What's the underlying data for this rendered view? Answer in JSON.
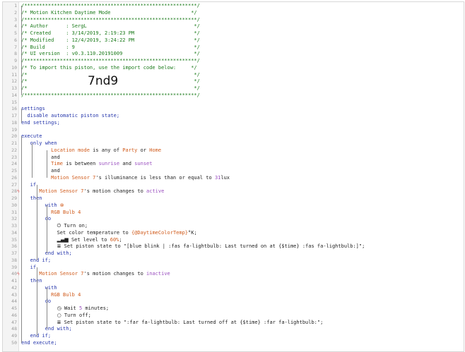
{
  "lines": [
    {
      "n": "1",
      "parts": [
        {
          "t": "/**********************************************************/",
          "c": "cm"
        }
      ]
    },
    {
      "n": "2",
      "parts": [
        {
          "t": "/* Motion Kitchen Daytime Mode                           */",
          "c": "cm"
        }
      ]
    },
    {
      "n": "3",
      "parts": [
        {
          "t": "/**********************************************************/",
          "c": "cm"
        }
      ]
    },
    {
      "n": "4",
      "parts": [
        {
          "t": "/* Author      : SergL                                    */",
          "c": "cm"
        }
      ]
    },
    {
      "n": "5",
      "parts": [
        {
          "t": "/* Created     : 3/14/2019, 2:19:23 PM                    */",
          "c": "cm"
        }
      ]
    },
    {
      "n": "6",
      "parts": [
        {
          "t": "/* Modified    : 12/4/2019, 3:24:22 PM                    */",
          "c": "cm"
        }
      ]
    },
    {
      "n": "7",
      "parts": [
        {
          "t": "/* Build       : 9                                        */",
          "c": "cm"
        }
      ]
    },
    {
      "n": "8",
      "parts": [
        {
          "t": "/* UI version  : v0.3.110.20191009                        */",
          "c": "cm"
        }
      ]
    },
    {
      "n": "9",
      "parts": [
        {
          "t": "/**********************************************************/",
          "c": "cm"
        }
      ]
    },
    {
      "n": "10",
      "parts": [
        {
          "t": "/* To import this piston, use the import code below:     */",
          "c": "cm"
        }
      ]
    },
    {
      "n": "11",
      "parts": [
        {
          "t": "/*                                                        */",
          "c": "cm"
        }
      ]
    },
    {
      "n": "12",
      "parts": [
        {
          "t": "/*                                                        */",
          "c": "cm"
        }
      ]
    },
    {
      "n": "13",
      "parts": [
        {
          "t": "/*                                                        */",
          "c": "cm"
        }
      ]
    },
    {
      "n": "14",
      "parts": [
        {
          "t": "/**********************************************************/",
          "c": "cm"
        }
      ]
    },
    {
      "n": "15",
      "parts": []
    },
    {
      "n": "16",
      "parts": [
        {
          "t": "settings",
          "c": "kw"
        }
      ]
    },
    {
      "n": "17",
      "parts": [
        {
          "t": "  disable automatic piston state;",
          "c": "kw"
        }
      ]
    },
    {
      "n": "18",
      "parts": [
        {
          "t": "end settings;",
          "c": "kw"
        }
      ]
    },
    {
      "n": "19",
      "parts": []
    },
    {
      "n": "20",
      "parts": [
        {
          "t": "execute",
          "c": "kw"
        }
      ]
    },
    {
      "n": "21",
      "parts": [
        {
          "t": "   only when",
          "c": "kw"
        }
      ]
    },
    {
      "n": "22",
      "parts": [
        {
          "t": "          Location mode",
          "c": "var"
        },
        {
          "t": " is any of ",
          "c": "plain"
        },
        {
          "t": "Party",
          "c": "var"
        },
        {
          "t": " or ",
          "c": "plain"
        },
        {
          "t": "Home",
          "c": "var"
        }
      ]
    },
    {
      "n": "23",
      "parts": [
        {
          "t": "          and",
          "c": "plain"
        }
      ]
    },
    {
      "n": "24",
      "parts": [
        {
          "t": "          Time",
          "c": "var"
        },
        {
          "t": " is between ",
          "c": "plain"
        },
        {
          "t": "sunrise",
          "c": "val"
        },
        {
          "t": " and ",
          "c": "plain"
        },
        {
          "t": "sunset",
          "c": "val"
        }
      ]
    },
    {
      "n": "25",
      "parts": [
        {
          "t": "          and",
          "c": "plain"
        }
      ]
    },
    {
      "n": "26",
      "parts": [
        {
          "t": "          Motion Sensor 7",
          "c": "var"
        },
        {
          "t": "'s illuminance is less than or equal to ",
          "c": "plain"
        },
        {
          "t": "31",
          "c": "val"
        },
        {
          "t": "lux",
          "c": "plain"
        }
      ]
    },
    {
      "n": "27",
      "parts": [
        {
          "t": "   if",
          "c": "kw"
        }
      ]
    },
    {
      "n": "28",
      "bolt": true,
      "parts": [
        {
          "t": "      Motion Sensor 7",
          "c": "var"
        },
        {
          "t": "'s motion changes to ",
          "c": "plain"
        },
        {
          "t": "active",
          "c": "val"
        }
      ]
    },
    {
      "n": "29",
      "parts": [
        {
          "t": "   then",
          "c": "kw"
        }
      ]
    },
    {
      "n": "30",
      "parts": [
        {
          "t": "        with ",
          "c": "kw"
        },
        {
          "t": "⊗",
          "c": "var",
          "icon": "stop-icon"
        }
      ]
    },
    {
      "n": "31",
      "parts": [
        {
          "t": "          RGB Bulb 4",
          "c": "var"
        }
      ]
    },
    {
      "n": "32",
      "parts": [
        {
          "t": "        do",
          "c": "kw"
        }
      ]
    },
    {
      "n": "33",
      "parts": [
        {
          "t": "            ",
          "c": "plain"
        },
        {
          "t": "⏻",
          "c": "plain",
          "icon": "power-icon"
        },
        {
          "t": " Turn on;",
          "c": "plain"
        }
      ]
    },
    {
      "n": "34",
      "parts": [
        {
          "t": "            Set color temperature to ",
          "c": "plain"
        },
        {
          "t": "{@DaytimeColorTemp}",
          "c": "var"
        },
        {
          "t": "°K;",
          "c": "plain"
        }
      ]
    },
    {
      "n": "35",
      "parts": [
        {
          "t": "            ",
          "c": "plain"
        },
        {
          "t": "▂▄▆",
          "c": "plain",
          "icon": "signal-icon"
        },
        {
          "t": " Set level to ",
          "c": "plain"
        },
        {
          "t": "60%",
          "c": "var"
        },
        {
          "t": ";",
          "c": "plain"
        }
      ]
    },
    {
      "n": "36",
      "parts": [
        {
          "t": "            ",
          "c": "plain"
        },
        {
          "t": "≣",
          "c": "plain",
          "icon": "list-icon"
        },
        {
          "t": " Set piston state to \"[blue blink | :fas fa-lightbulb: Last turned on at {$time} :fas fa-lightbulb:]\";",
          "c": "plain"
        }
      ]
    },
    {
      "n": "37",
      "parts": [
        {
          "t": "        end with;",
          "c": "kw"
        }
      ]
    },
    {
      "n": "38",
      "parts": [
        {
          "t": "   end if;",
          "c": "kw"
        }
      ]
    },
    {
      "n": "39",
      "parts": [
        {
          "t": "   if",
          "c": "kw"
        }
      ]
    },
    {
      "n": "40",
      "bolt": true,
      "parts": [
        {
          "t": "      Motion Sensor 7",
          "c": "var"
        },
        {
          "t": "'s motion changes to ",
          "c": "plain"
        },
        {
          "t": "inactive",
          "c": "val"
        }
      ]
    },
    {
      "n": "41",
      "parts": [
        {
          "t": "   then",
          "c": "kw"
        }
      ]
    },
    {
      "n": "42",
      "parts": [
        {
          "t": "        with",
          "c": "kw"
        }
      ]
    },
    {
      "n": "43",
      "parts": [
        {
          "t": "          RGB Bulb 4",
          "c": "var"
        }
      ]
    },
    {
      "n": "44",
      "parts": [
        {
          "t": "        do",
          "c": "kw"
        }
      ]
    },
    {
      "n": "45",
      "parts": [
        {
          "t": "            ",
          "c": "plain"
        },
        {
          "t": "◷",
          "c": "plain",
          "icon": "clock-icon"
        },
        {
          "t": " Wait ",
          "c": "plain"
        },
        {
          "t": "5",
          "c": "val"
        },
        {
          "t": " minutes;",
          "c": "plain"
        }
      ]
    },
    {
      "n": "46",
      "parts": [
        {
          "t": "            ",
          "c": "plain"
        },
        {
          "t": "○",
          "c": "plain",
          "icon": "circle-icon"
        },
        {
          "t": " Turn off;",
          "c": "plain"
        }
      ]
    },
    {
      "n": "47",
      "parts": [
        {
          "t": "            ",
          "c": "plain"
        },
        {
          "t": "≣",
          "c": "plain",
          "icon": "list-icon"
        },
        {
          "t": " Set piston state to \":far fa-lightbulb: Last turned off at {$time} :far fa-lightbulb:\";",
          "c": "plain"
        }
      ]
    },
    {
      "n": "48",
      "parts": [
        {
          "t": "        end with;",
          "c": "kw"
        }
      ]
    },
    {
      "n": "49",
      "parts": [
        {
          "t": "   end if;",
          "c": "kw"
        }
      ]
    },
    {
      "n": "50",
      "parts": [
        {
          "t": "end execute;",
          "c": "kw"
        }
      ]
    }
  ],
  "import_code": "7nd9",
  "colors": {
    "comment": "#1a7a1a",
    "keyword": "#2233aa",
    "variable": "#d05a1a",
    "value": "#9a4fbf",
    "bolt": "#e05050"
  }
}
